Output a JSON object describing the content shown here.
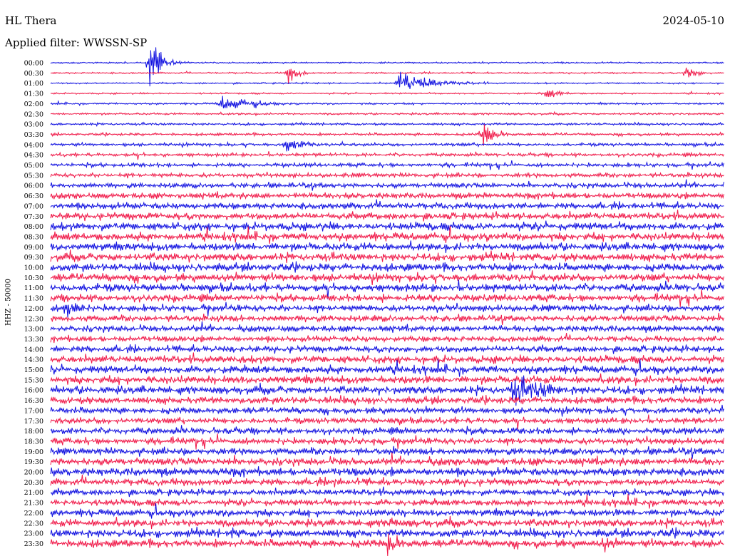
{
  "header": {
    "station": "HL Thera",
    "date": "2024-05-10",
    "filter_label": "Applied filter: WWSSN-SP"
  },
  "chart_data": {
    "type": "line",
    "title": "HL Thera",
    "channel_label": "HHZ - 50000",
    "x_unit": "minutes within 30-min row",
    "xlim": [
      0,
      30
    ],
    "row_labels": [
      "00:00",
      "00:30",
      "01:00",
      "01:30",
      "02:00",
      "02:30",
      "03:00",
      "03:30",
      "04:00",
      "04:30",
      "05:00",
      "05:30",
      "06:00",
      "06:30",
      "07:00",
      "07:30",
      "08:00",
      "08:30",
      "09:00",
      "09:30",
      "10:00",
      "10:30",
      "11:00",
      "11:30",
      "12:00",
      "12:30",
      "13:00",
      "13:30",
      "14:00",
      "14:30",
      "15:00",
      "15:30",
      "16:00",
      "16:30",
      "17:00",
      "17:30",
      "18:00",
      "18:30",
      "19:00",
      "19:30",
      "20:00",
      "20:30",
      "21:00",
      "21:30",
      "22:00",
      "22:30",
      "23:00",
      "23:30"
    ],
    "colors": [
      "#1010e0",
      "#f01848"
    ],
    "noise_amplitude": [
      1.0,
      1.0,
      1.0,
      1.0,
      1.2,
      1.3,
      1.5,
      1.7,
      2.0,
      2.2,
      2.5,
      2.8,
      3.2,
      3.6,
      4.0,
      4.5,
      5.0,
      5.0,
      5.0,
      5.0,
      5.0,
      5.0,
      5.0,
      4.6,
      4.3,
      4.0,
      3.8,
      3.6,
      4.2,
      4.8,
      5.0,
      5.0,
      5.0,
      4.5,
      4.0,
      3.8,
      4.2,
      4.2,
      4.5,
      4.8,
      5.0,
      4.5,
      4.0,
      4.2,
      4.5,
      4.8,
      5.0,
      5.0
    ],
    "events": [
      {
        "row": 0,
        "minute": 4.4,
        "amplitude": 42,
        "duration": 0.3
      },
      {
        "row": 1,
        "minute": 10.5,
        "amplitude": 18,
        "duration": 0.3
      },
      {
        "row": 1,
        "minute": 28.3,
        "amplitude": 15,
        "duration": 0.3
      },
      {
        "row": 2,
        "minute": 15.5,
        "amplitude": 16,
        "duration": 1.0
      },
      {
        "row": 3,
        "minute": 22.0,
        "amplitude": 8,
        "duration": 0.5
      },
      {
        "row": 4,
        "minute": 7.5,
        "amplitude": 12,
        "duration": 1.0
      },
      {
        "row": 7,
        "minute": 19.2,
        "amplitude": 20,
        "duration": 0.4
      },
      {
        "row": 8,
        "minute": 10.5,
        "amplitude": 20,
        "duration": 0.4
      },
      {
        "row": 24,
        "minute": 0.6,
        "amplitude": 18,
        "duration": 0.6
      },
      {
        "row": 32,
        "minute": 20.5,
        "amplitude": 20,
        "duration": 1.5
      },
      {
        "row": 41,
        "minute": 12.5,
        "amplitude": 12,
        "duration": 0.3
      },
      {
        "row": 45,
        "minute": 15.0,
        "amplitude": 14,
        "duration": 0.4
      },
      {
        "row": 46,
        "minute": 8.0,
        "amplitude": 10,
        "duration": 0.4
      },
      {
        "row": 47,
        "minute": 15.0,
        "amplitude": 22,
        "duration": 0.4
      },
      {
        "row": 47,
        "minute": 24.5,
        "amplitude": 16,
        "duration": 0.4
      }
    ]
  }
}
